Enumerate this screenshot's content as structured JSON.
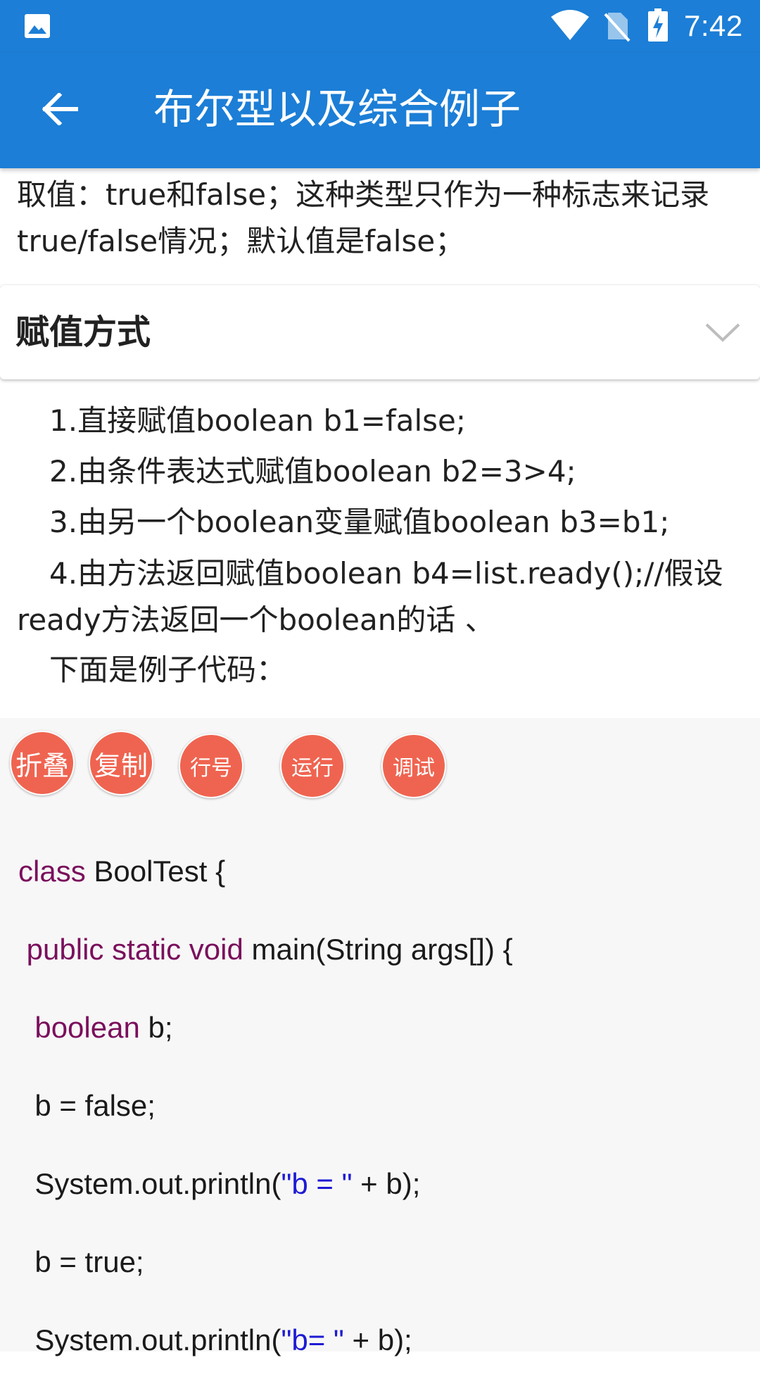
{
  "status_bar": {
    "time": "7:42",
    "icons": [
      "gallery-icon",
      "wifi-icon",
      "no-sim-icon",
      "battery-charging-icon"
    ]
  },
  "app_bar": {
    "title": "布尔型以及综合例子",
    "back_icon": "arrow-left-icon"
  },
  "intro": {
    "text": "取值：true和false；这种类型只作为一种标志来记录true/false情况；默认值是false；"
  },
  "section": {
    "title": "赋值方式",
    "expand_icon": "chevron-down-icon"
  },
  "assignments": {
    "item1": "1.直接赋值boolean b1=false;",
    "item2": "2.由条件表达式赋值boolean b2=3>4;",
    "item3": "3.由另一个boolean变量赋值boolean b3=b1;",
    "item4": "4.由方法返回赋值boolean b4=list.ready();//假设ready方法返回一个boolean的话        、",
    "example_intro": "下面是例子代码："
  },
  "code_actions": {
    "fold": "折叠",
    "copy": "复制",
    "line_numbers": "行号",
    "run": "运行",
    "debug": "调试"
  },
  "code": {
    "l1_kw": "class",
    "l1_rest": " BoolTest {",
    "l2_indent": " ",
    "l2_kw": "public static void",
    "l2_rest": " main(String args[]) {",
    "l3_indent": "  ",
    "l3_kw": "boolean",
    "l3_rest": " b;",
    "l4": "  b = false;",
    "l5_pre": "  System.out.println(",
    "l5_str": "\"b = \"",
    "l5_post": " + b);",
    "l6": "  b = true;",
    "l7_pre": "  System.out.println(",
    "l7_str": "\"b= \"",
    "l7_post": " + b);"
  },
  "colors": {
    "primary": "#1c7ed6",
    "action_button": "#ef6450",
    "keyword": "#7a0f5c",
    "string": "#1d1ad4",
    "code_background": "#f7f7f7"
  }
}
